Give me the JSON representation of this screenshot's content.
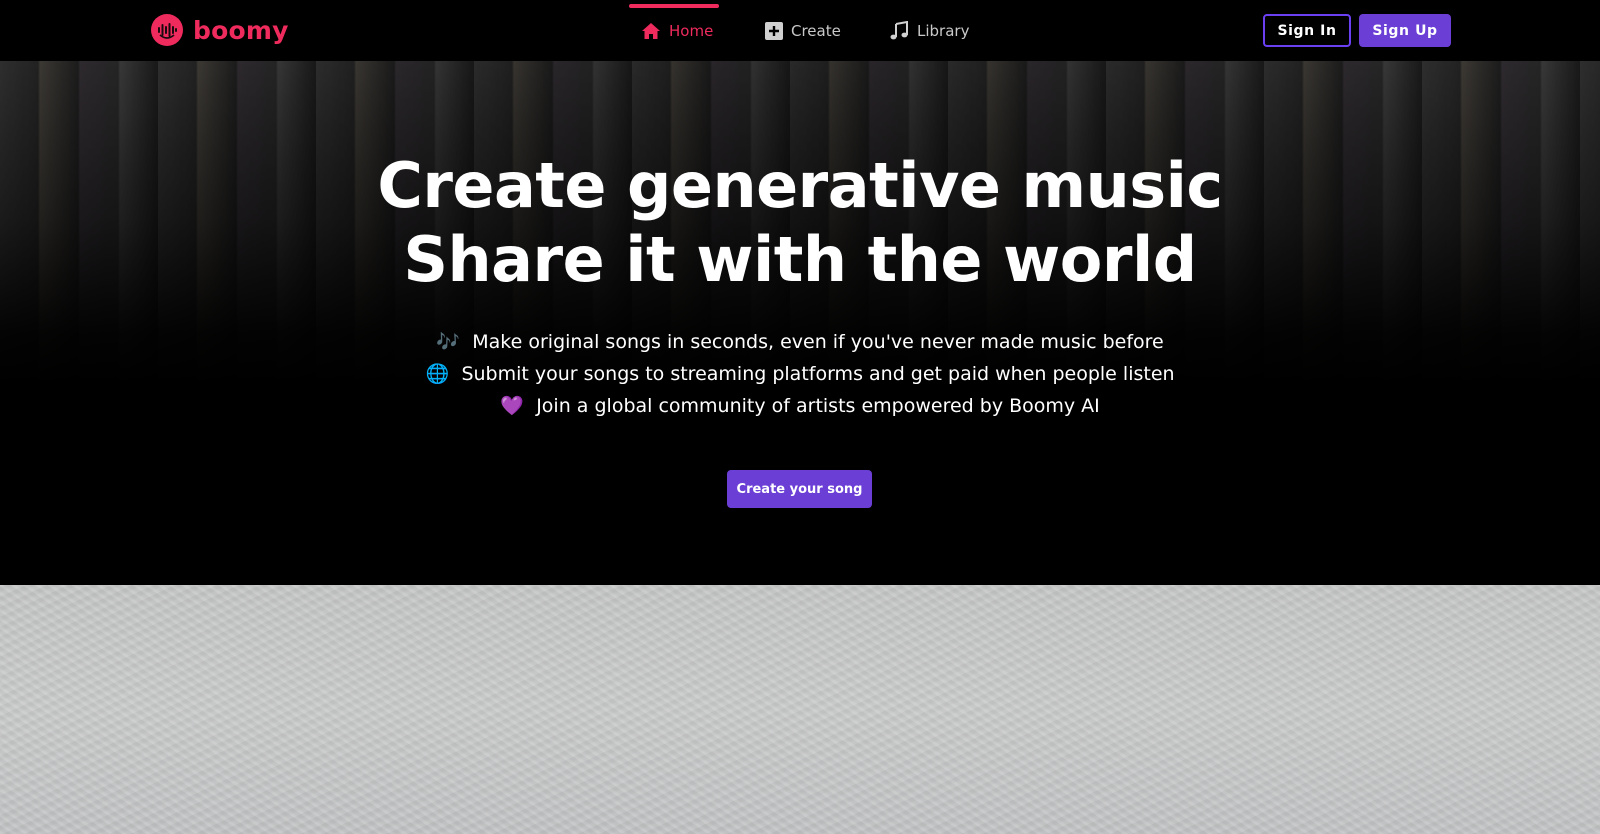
{
  "brand": {
    "name": "boomy",
    "color": "#ee2b5c"
  },
  "nav": {
    "items": [
      {
        "label": "Home",
        "icon": "home-icon",
        "active": true
      },
      {
        "label": "Create",
        "icon": "plus-square-icon",
        "active": false
      },
      {
        "label": "Library",
        "icon": "music-note-icon",
        "active": false
      }
    ],
    "sign_in": "Sign In",
    "sign_up": "Sign Up"
  },
  "hero": {
    "headline_line1": "Create generative music",
    "headline_line2": "Share it with the world",
    "features": [
      {
        "icon": "musical-notes-emoji",
        "glyph": "🎶",
        "text": "Make original songs in seconds, even if you've never made music before"
      },
      {
        "icon": "globe-emoji",
        "glyph": "🌐",
        "text": "Submit your songs to streaming platforms and get paid when people listen"
      },
      {
        "icon": "purple-heart-emoji",
        "glyph": "💜",
        "text": "Join a global community of artists empowered by Boomy AI"
      }
    ],
    "cta": "Create your song"
  },
  "colors": {
    "accent": "#ee2b5c",
    "button_purple": "#6b3fd6",
    "background": "#000000",
    "lower_section": "#c7c8c8"
  }
}
